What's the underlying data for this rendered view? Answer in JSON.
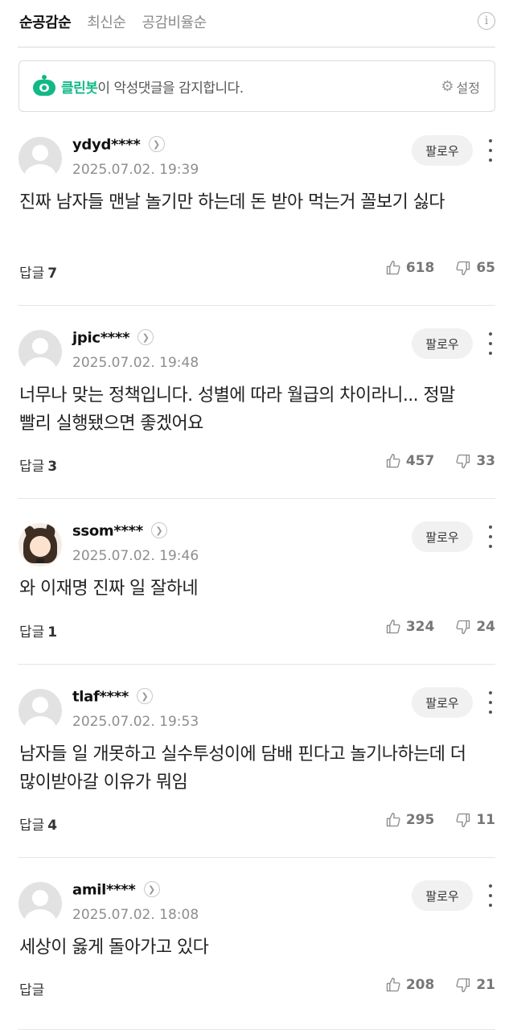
{
  "sort_tabs": [
    {
      "label": "순공감순",
      "active": true
    },
    {
      "label": "최신순",
      "active": false
    },
    {
      "label": "공감비율순",
      "active": false
    }
  ],
  "info_icon": "i",
  "cleanbot": {
    "name": "클린봇",
    "message": "이 악성댓글을 감지합니다.",
    "settings_label": "설정"
  },
  "follow_label": "팔로우",
  "reply_label": "답글",
  "comments": [
    {
      "nickname": "ydyd****",
      "date": "2025.07.02. 19:39",
      "text": "진짜 남자들 맨날 놀기만 하는데 돈 받아 먹는거 꼴보기 싫다",
      "replies": "7",
      "likes": "618",
      "dislikes": "65",
      "avatar": "default"
    },
    {
      "nickname": "jpic****",
      "date": "2025.07.02. 19:48",
      "text": "너무나 맞는 정책입니다. 성별에 따라 월급의 차이라니... 정말 빨리 실행됐으면 좋겠어요",
      "replies": "3",
      "likes": "457",
      "dislikes": "33",
      "avatar": "default"
    },
    {
      "nickname": "ssom****",
      "date": "2025.07.02. 19:46",
      "text": "와 이재명 진짜 일 잘하네",
      "replies": "1",
      "likes": "324",
      "dislikes": "24",
      "avatar": "custom"
    },
    {
      "nickname": "tlaf****",
      "date": "2025.07.02. 19:53",
      "text": "남자들 일 개못하고 실수투성이에 담배 핀다고 놀기나하는데 더 많이받아갈 이유가 뭐임",
      "replies": "4",
      "likes": "295",
      "dislikes": "11",
      "avatar": "default"
    },
    {
      "nickname": "amil****",
      "date": "2025.07.02. 18:08",
      "text": "세상이 옳게 돌아가고 있다",
      "replies": "",
      "likes": "208",
      "dislikes": "21",
      "avatar": "default"
    }
  ]
}
